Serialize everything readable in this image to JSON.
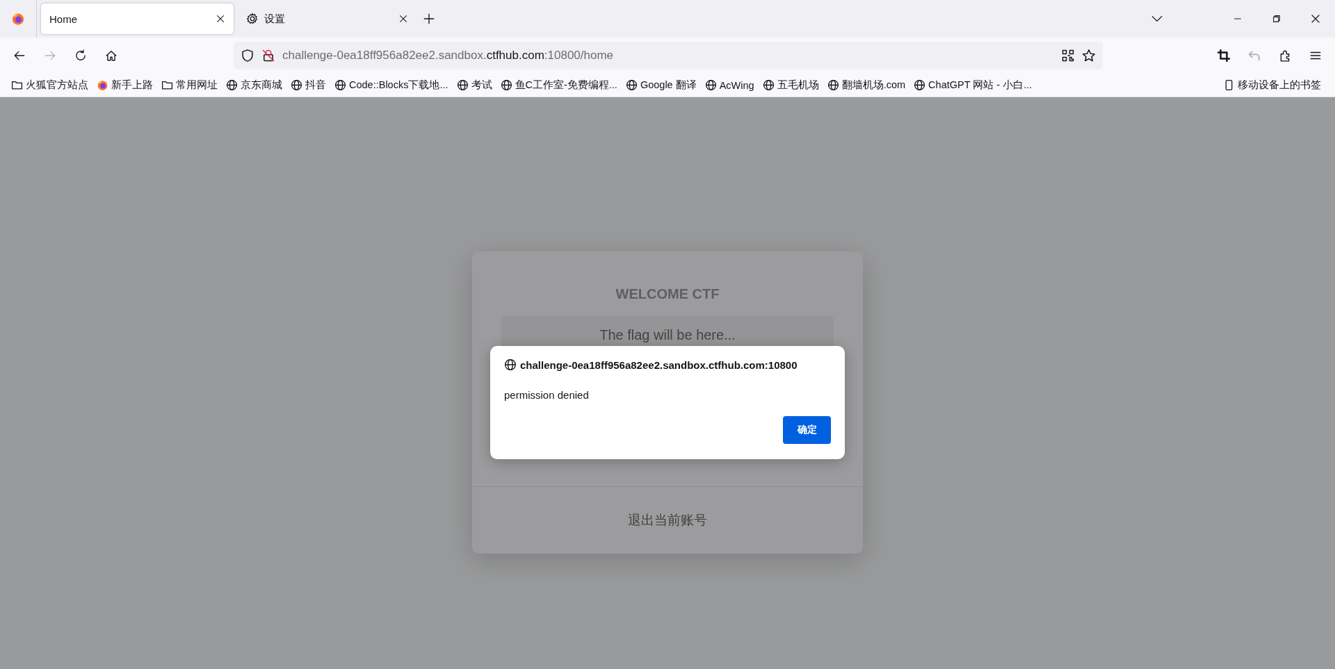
{
  "tabs": [
    {
      "title": "Home",
      "kind": "plain",
      "selected": true
    },
    {
      "title": "设置",
      "kind": "settings",
      "selected": false
    }
  ],
  "nav_buttons": [
    {
      "kind": "back",
      "disabled": false
    },
    {
      "kind": "forward",
      "disabled": true
    },
    {
      "kind": "reload",
      "disabled": false
    },
    {
      "kind": "home",
      "disabled": false
    }
  ],
  "address_bar": {
    "url": "challenge-0ea18ff956a82ee2.sandbox.**ctfhub.com**:10800/home"
  },
  "toolbar_right": [
    {
      "kind": "crop",
      "disabled": false
    },
    {
      "kind": "undo",
      "disabled": true
    },
    {
      "kind": "extensions",
      "disabled": false
    },
    {
      "kind": "menu",
      "disabled": false
    }
  ],
  "bookmarks": [
    {
      "label": "火狐官方站点",
      "kind": "folder"
    },
    {
      "label": "新手上路",
      "kind": "firefox"
    },
    {
      "label": "常用网址",
      "kind": "folder"
    },
    {
      "label": "京东商城",
      "kind": "globe"
    },
    {
      "label": "抖音",
      "kind": "globe"
    },
    {
      "label": "Code::Blocks下载地...",
      "kind": "globe"
    },
    {
      "label": "考试",
      "kind": "globe"
    },
    {
      "label": "鱼C工作室-免费编程...",
      "kind": "globe"
    },
    {
      "label": "Google 翻译",
      "kind": "globe"
    },
    {
      "label": "AcWing",
      "kind": "globe"
    },
    {
      "label": "五毛机场",
      "kind": "globe"
    },
    {
      "label": "翻墙机场.com",
      "kind": "globe"
    },
    {
      "label": "ChatGPT 网站 - 小白...",
      "kind": "globe"
    }
  ],
  "mobile_bookmarks": "移动设备上的书签",
  "card": {
    "title": "WELCOME CTF",
    "flag_text": "The flag will be here...",
    "logout": "退出当前账号"
  },
  "dialog": {
    "origin": "challenge-0ea18ff956a82ee2.sandbox.ctfhub.com:10800",
    "message": "permission denied",
    "ok_button": "确定"
  }
}
